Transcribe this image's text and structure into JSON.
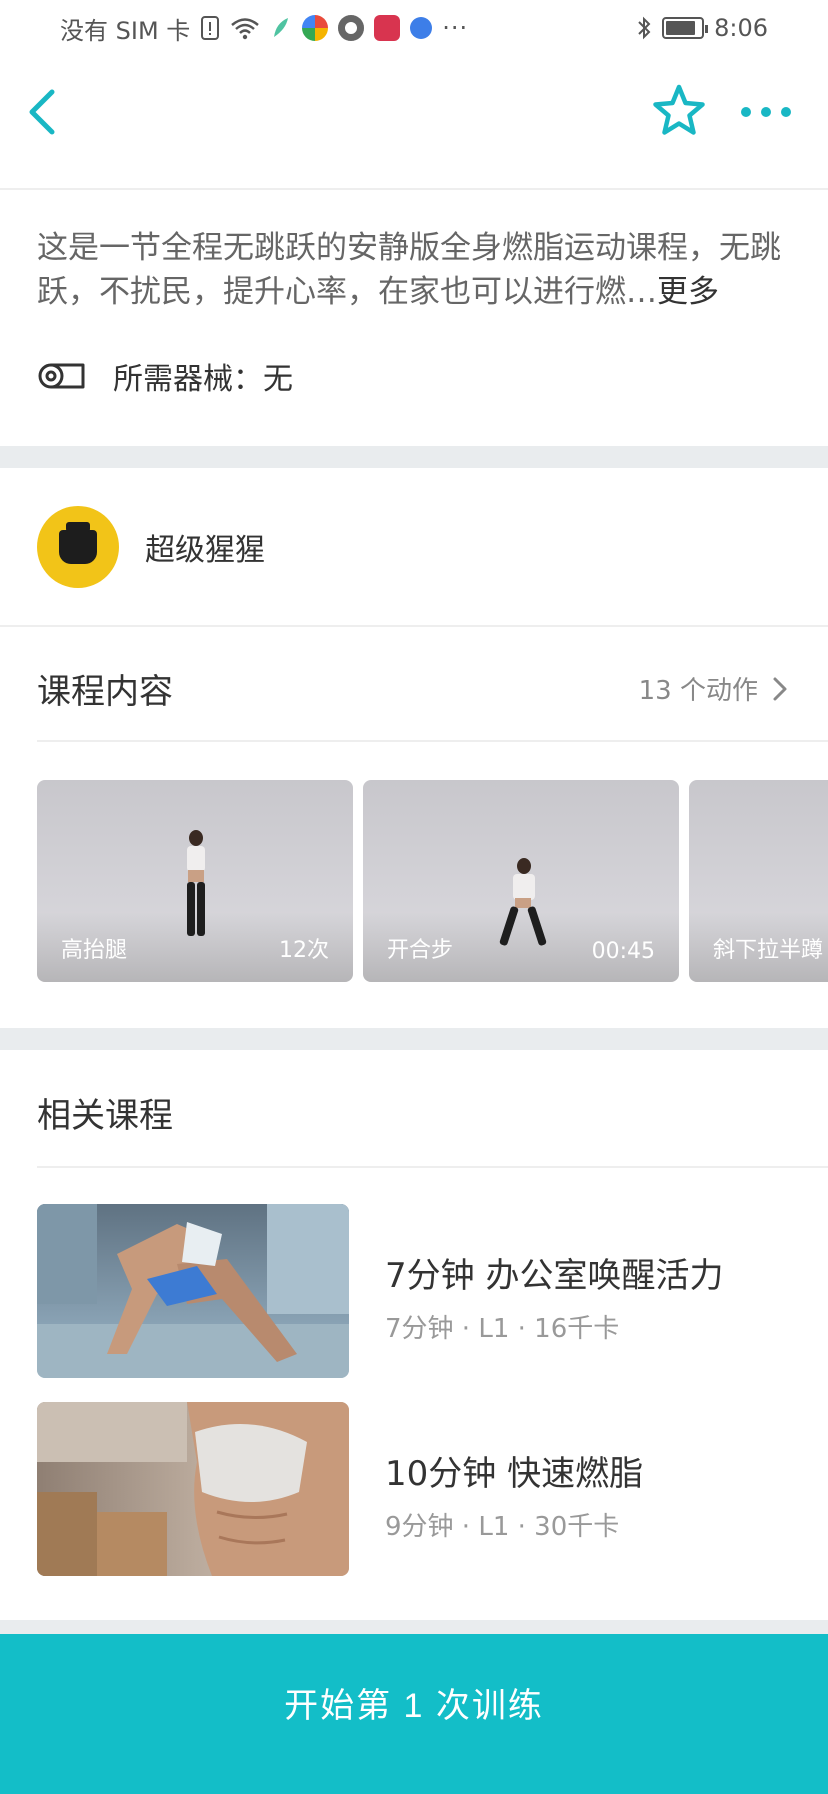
{
  "status_bar": {
    "carrier": "没有 SIM 卡",
    "time": "8:06",
    "overflow": "···",
    "icons": [
      "sim-alert-icon",
      "wifi-icon",
      "feather-icon",
      "color-app-icon",
      "aperture-icon",
      "calendar-app-icon",
      "globe-icon",
      "bluetooth-icon",
      "battery-icon"
    ],
    "battery_level": 0.85
  },
  "nav": {
    "back_icon": "chevron-left-icon",
    "favorite_icon": "star-outline-icon",
    "more_icon": "more-dots-icon",
    "accent": "#19b7c4"
  },
  "course": {
    "description": "这是一节全程无跳跃的安静版全身燃脂运动课程，无跳跃，不扰民，提升心率，在家也可以进行燃…",
    "more_label": "更多",
    "equipment_icon": "yoga-mat-icon",
    "equipment": "所需器械：无"
  },
  "coach": {
    "name": "超级猩猩"
  },
  "content_section": {
    "title": "课程内容",
    "count_label": "13 个动作",
    "arrow_icon": "chevron-right-icon",
    "exercises": [
      {
        "name": "高抬腿",
        "meta": "12次"
      },
      {
        "name": "开合步",
        "meta": "00:45"
      },
      {
        "name": "斜下拉半蹲",
        "meta": ""
      }
    ]
  },
  "related_section": {
    "title": "相关课程",
    "items": [
      {
        "title": "7分钟 办公室唤醒活力",
        "subtitle": "7分钟 · L1 · 16千卡"
      },
      {
        "title": "10分钟 快速燃脂",
        "subtitle": "9分钟 · L1 · 30千卡"
      }
    ]
  },
  "start_button": {
    "label": "开始第 1 次训练",
    "color": "#13bec8"
  }
}
